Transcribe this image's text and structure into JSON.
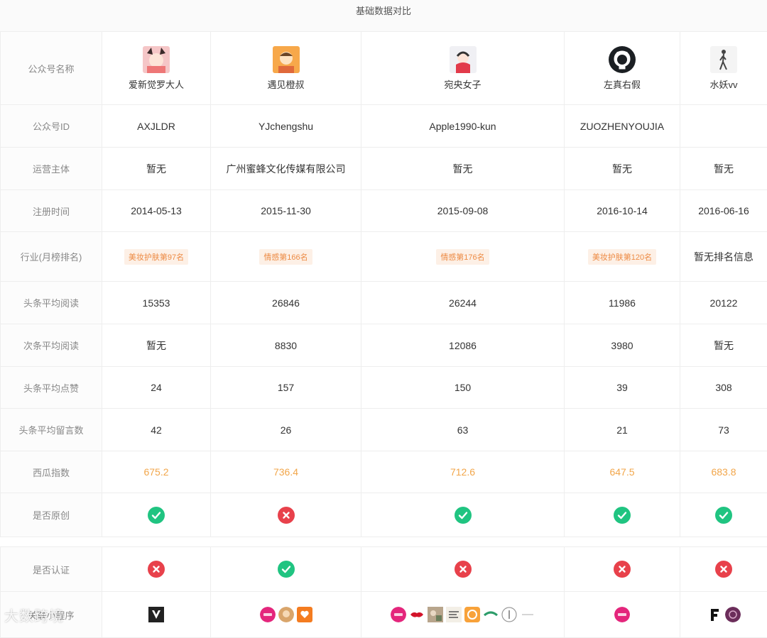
{
  "title": "基础数据对比",
  "labels": {
    "name": "公众号名称",
    "id": "公众号ID",
    "operator": "运营主体",
    "reg_date": "注册时间",
    "industry": "行业(月榜排名)",
    "head_read": "头条平均阅读",
    "second_read": "次条平均阅读",
    "head_like": "头条平均点赞",
    "head_comment": "头条平均留言数",
    "xigua": "西瓜指数",
    "original": "是否原创",
    "certified": "是否认证",
    "mini_program": "关联小程序"
  },
  "accounts": [
    {
      "name": "爱新觉罗大人",
      "avatar_icon": "girl-cat-ears-avatar",
      "id": "AXJLDR",
      "operator": "暂无",
      "reg_date": "2014-05-13",
      "industry": "美妆护肤第97名",
      "industry_is_tag": true,
      "head_read": "15353",
      "second_read": "暂无",
      "head_like": "24",
      "head_comment": "42",
      "xigua": "675.2",
      "original": "yes",
      "certified": "no",
      "mini_programs": [
        "v-logo-icon"
      ]
    },
    {
      "name": "遇见橙叔",
      "avatar_icon": "cartoon-man-avatar",
      "id": "YJchengshu",
      "operator": "广州蜜蜂文化传媒有限公司",
      "reg_date": "2015-11-30",
      "industry": "情感第166名",
      "industry_is_tag": true,
      "head_read": "26846",
      "second_read": "8830",
      "head_like": "157",
      "head_comment": "26",
      "xigua": "736.4",
      "original": "no",
      "certified": "yes",
      "mini_programs": [
        "pink-circle-icon",
        "face-circle-icon",
        "orange-heart-icon"
      ]
    },
    {
      "name": "宛央女子",
      "avatar_icon": "red-scarf-girl-avatar",
      "id": "Apple1990-kun",
      "operator": "暂无",
      "reg_date": "2015-09-08",
      "industry": "情感第176名",
      "industry_is_tag": true,
      "head_read": "26244",
      "second_read": "12086",
      "head_like": "150",
      "head_comment": "63",
      "xigua": "712.6",
      "original": "yes",
      "certified": "no",
      "mini_programs": [
        "pink-circle-icon",
        "red-lips-icon",
        "photo-icon",
        "text-icon",
        "orange-swirl-icon",
        "green-logo-icon",
        "gray-circle-icon",
        "line-icon"
      ]
    },
    {
      "name": "左真右假",
      "avatar_icon": "github-cat-avatar",
      "id": "ZUOZHENYOUJIA",
      "operator": "暂无",
      "reg_date": "2016-10-14",
      "industry": "美妆护肤第120名",
      "industry_is_tag": true,
      "head_read": "11986",
      "second_read": "3980",
      "head_like": "39",
      "head_comment": "21",
      "xigua": "647.5",
      "original": "yes",
      "certified": "no",
      "mini_programs": [
        "pink-circle-icon"
      ]
    },
    {
      "name": "水妖vv",
      "avatar_icon": "walking-figure-avatar",
      "id": "",
      "operator": "暂无",
      "reg_date": "2016-06-16",
      "industry": "暂无排名信息",
      "industry_is_tag": false,
      "head_read": "20122",
      "second_read": "暂无",
      "head_like": "308",
      "head_comment": "73",
      "xigua": "683.8",
      "original": "yes",
      "certified": "no",
      "mini_programs": [
        "f-letter-icon",
        "purple-pattern-icon"
      ]
    }
  ],
  "colors": {
    "yes": "#20c481",
    "no": "#e8414b",
    "tag_bg": "#fdf0e6",
    "tag_text": "#ed8a43",
    "score": "#f2a64a"
  },
  "watermark": "大数跨境"
}
